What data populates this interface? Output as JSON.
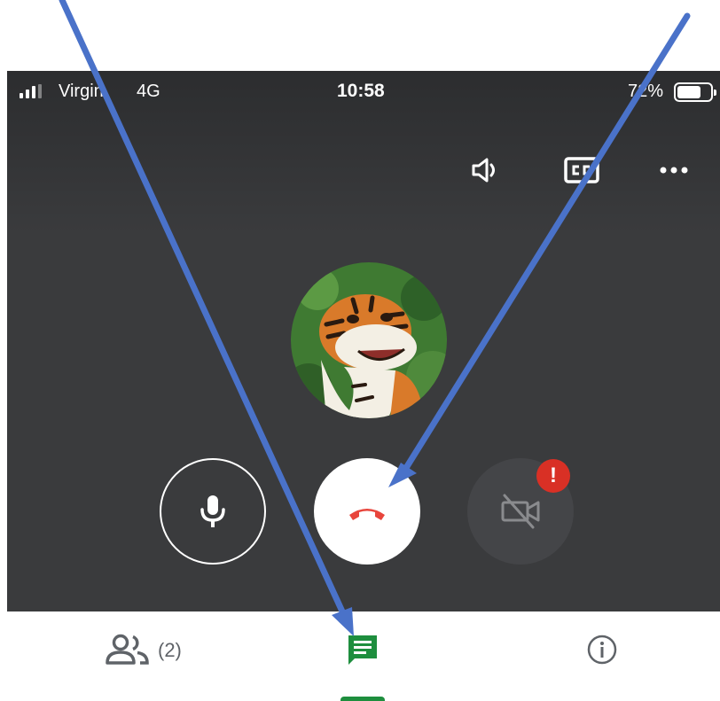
{
  "status_bar": {
    "carrier": "Virgin",
    "network": "4G",
    "time": "10:58",
    "battery": "72%",
    "battery_level": 0.72
  },
  "toolbar": {
    "icons": [
      "speaker-icon",
      "captions-icon",
      "more-options-icon"
    ]
  },
  "call": {
    "avatar": "participant-avatar",
    "controls": [
      "microphone-icon",
      "hang-up-icon",
      "camera-off-icon"
    ],
    "alert_badge": "!"
  },
  "bottom_tabs": {
    "people_count": "(2)",
    "active_tab": "chat"
  },
  "colors": {
    "call_background": "#3a3b3d",
    "hangup_red": "#e8453c",
    "alert_red": "#d93025",
    "active_green": "#1e8e3e",
    "annotation_arrow": "#4a72c9"
  }
}
